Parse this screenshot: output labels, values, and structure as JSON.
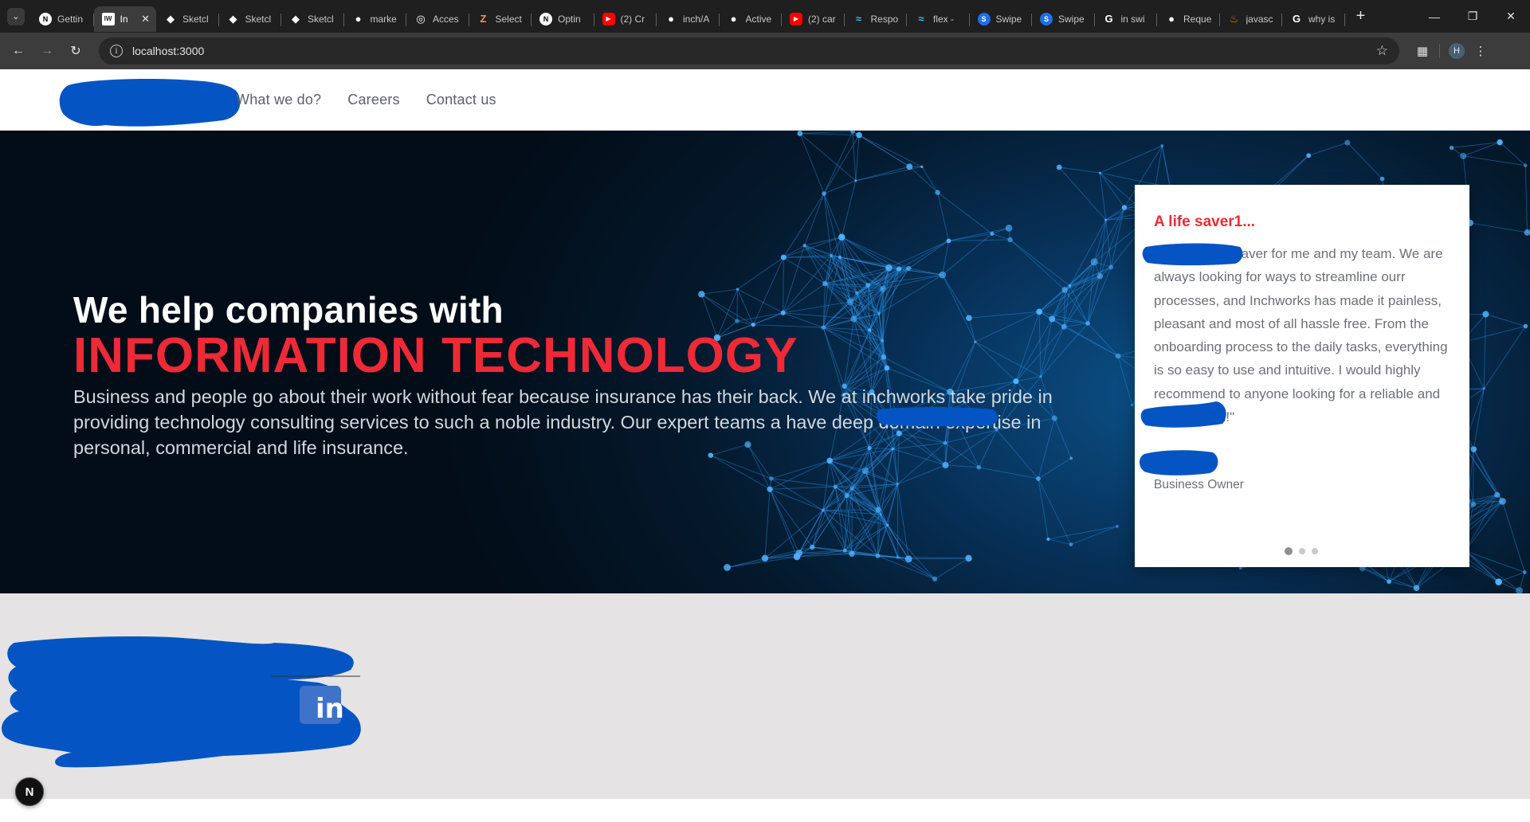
{
  "browser": {
    "tabs": [
      {
        "title": "Gettin",
        "icon": "nextjs-icon",
        "color": "#000000"
      },
      {
        "title": "In",
        "icon": "inchworks-icon",
        "color": "#222222",
        "active": true
      },
      {
        "title": "Sketcl",
        "icon": "sketch-icon",
        "color": "#ffffff"
      },
      {
        "title": "Sketcl",
        "icon": "sketch-icon",
        "color": "#ffffff"
      },
      {
        "title": "Sketcl",
        "icon": "sketch-icon",
        "color": "#ffffff"
      },
      {
        "title": "marke",
        "icon": "github-icon",
        "color": "#ffffff"
      },
      {
        "title": "Acces",
        "icon": "globe-icon",
        "color": "#ffffff"
      },
      {
        "title": "Select",
        "icon": "zoho-icon",
        "color": "#e8a23b"
      },
      {
        "title": "Optin",
        "icon": "nextjs-icon",
        "color": "#000000"
      },
      {
        "title": "(2) Cr",
        "icon": "youtube-icon",
        "color": "#ff0000"
      },
      {
        "title": "inch/A",
        "icon": "github-icon",
        "color": "#ffffff"
      },
      {
        "title": "Active",
        "icon": "github-icon",
        "color": "#ffffff"
      },
      {
        "title": "(2) car",
        "icon": "youtube-icon",
        "color": "#ff0000"
      },
      {
        "title": "Respo",
        "icon": "tailwind-icon",
        "color": "#38bdf8"
      },
      {
        "title": "flex -",
        "icon": "tailwind-icon",
        "color": "#38bdf8"
      },
      {
        "title": "Swipe",
        "icon": "swiper-icon",
        "color": "#1f6feb"
      },
      {
        "title": "Swipe",
        "icon": "swiper-icon",
        "color": "#1f6feb"
      },
      {
        "title": "in swi",
        "icon": "google-icon",
        "color": "#ffffff"
      },
      {
        "title": "Reque",
        "icon": "github-icon",
        "color": "#ffffff"
      },
      {
        "title": "javasc",
        "icon": "java-icon",
        "color": "#e76f00"
      },
      {
        "title": "why is",
        "icon": "google-icon",
        "color": "#ffffff"
      }
    ],
    "url": "localhost:3000",
    "profile_initial": "H"
  },
  "nav": {
    "links": [
      "What we do?",
      "Careers",
      "Contact us"
    ]
  },
  "hero": {
    "line1": "We help companies with",
    "line2": "INFORMATION TECHNOLOGY",
    "description": "Business and people go about their work without fear because insurance has their back. We at inchworks take pride in providing technology consulting services to such a noble industry. Our expert teams a            have deep domain expertise in personal, commercial and life insurance."
  },
  "testimonial": {
    "title": "A life saver1...",
    "body": "               as been a lifesaver for me and my team. We are always looking for ways to streamline ourr processes, and Inchworks has made it painless, pleasant and most of all hassle free. From the onboarding process to the daily tasks, everything is so easy to use and intuitive. I would highly recommend              to anyone looking for a reliable and efficient tool!\"",
    "role": "Business Owner",
    "slides": 3,
    "active_slide": 0
  },
  "badge": {
    "label": "N"
  },
  "colors": {
    "accent_red": "#ee2a37",
    "redaction_blue": "#0454c4",
    "hero_dark": "#04192c"
  }
}
